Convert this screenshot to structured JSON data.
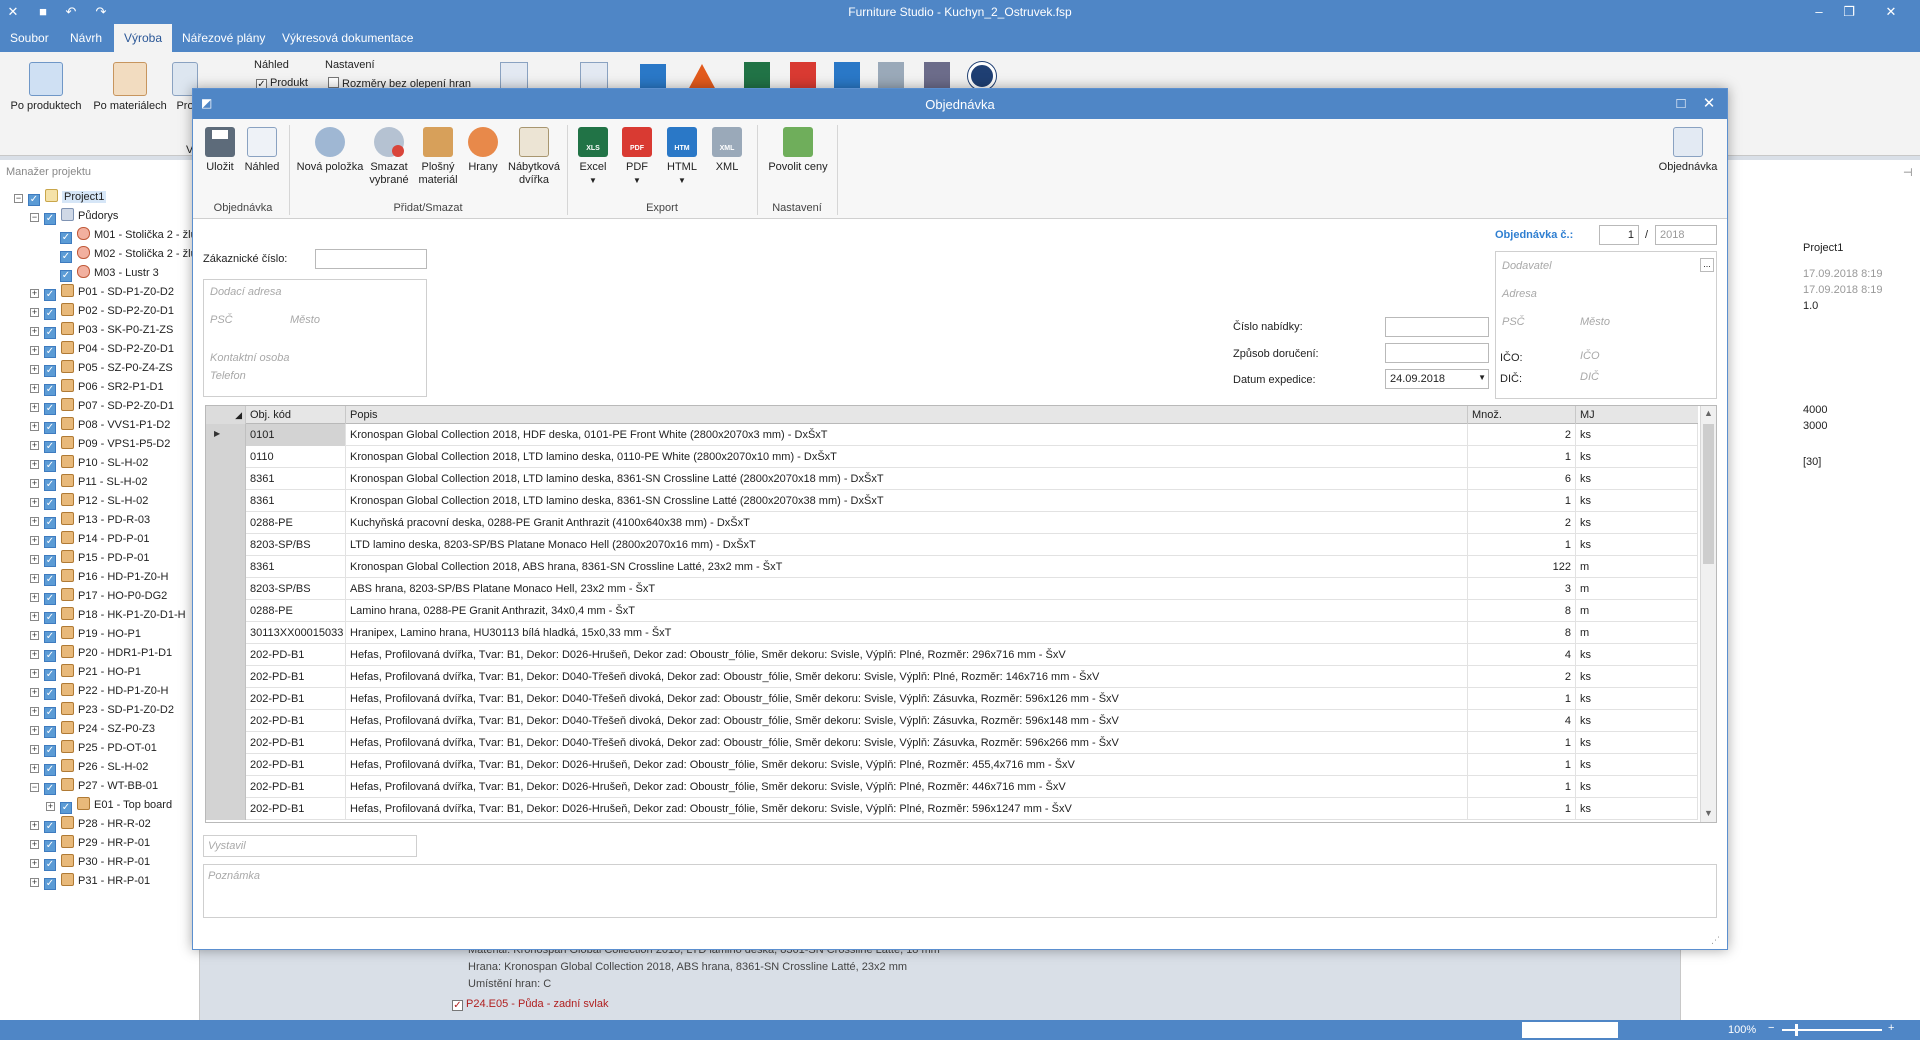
{
  "app": {
    "title": "Furniture Studio - Kuchyn_2_Ostruvek.fsp",
    "menu": [
      "Soubor",
      "Návrh",
      "Výroba",
      "Nářezové plány",
      "Výkresová dokumentace"
    ],
    "ribbon": {
      "po_produktech": "Po produktech",
      "po_materialech": "Po materiálech",
      "pro": "Pro",
      "nahled": "Náhled",
      "produkt": "Produkt",
      "nastaveni": "Nastavení",
      "rozmery": "Rozměry bez olepení hran",
      "v": "V"
    },
    "status": {
      "zoom": "100%"
    }
  },
  "project_panel": {
    "title": "Manažer projektu",
    "items": [
      {
        "label": "Project1",
        "level": 0,
        "icon": "proj",
        "exp": "−"
      },
      {
        "label": "Půdorys",
        "level": 1,
        "icon": "plan",
        "exp": "−"
      },
      {
        "label": "M01 - Stolička 2 - žlu",
        "level": 2,
        "icon": "mod",
        "exp": ""
      },
      {
        "label": "M02 - Stolička 2 - žlu",
        "level": 2,
        "icon": "mod",
        "exp": ""
      },
      {
        "label": "M03 - Lustr 3",
        "level": 2,
        "icon": "mod",
        "exp": ""
      },
      {
        "label": "P01 - SD-P1-Z0-D2",
        "level": 1,
        "icon": "prod",
        "exp": "+"
      },
      {
        "label": "P02 - SD-P2-Z0-D1",
        "level": 1,
        "icon": "prod",
        "exp": "+"
      },
      {
        "label": "P03 - SK-P0-Z1-ZS",
        "level": 1,
        "icon": "prod",
        "exp": "+"
      },
      {
        "label": "P04 - SD-P2-Z0-D1",
        "level": 1,
        "icon": "prod",
        "exp": "+"
      },
      {
        "label": "P05 - SZ-P0-Z4-ZS",
        "level": 1,
        "icon": "prod",
        "exp": "+"
      },
      {
        "label": "P06 - SR2-P1-D1",
        "level": 1,
        "icon": "prod",
        "exp": "+"
      },
      {
        "label": "P07 - SD-P2-Z0-D1",
        "level": 1,
        "icon": "prod",
        "exp": "+"
      },
      {
        "label": "P08 - VVS1-P1-D2",
        "level": 1,
        "icon": "prod",
        "exp": "+"
      },
      {
        "label": "P09 - VPS1-P5-D2",
        "level": 1,
        "icon": "prod",
        "exp": "+"
      },
      {
        "label": "P10 - SL-H-02",
        "level": 1,
        "icon": "prod",
        "exp": "+"
      },
      {
        "label": "P11 - SL-H-02",
        "level": 1,
        "icon": "prod",
        "exp": "+"
      },
      {
        "label": "P12 - SL-H-02",
        "level": 1,
        "icon": "prod",
        "exp": "+"
      },
      {
        "label": "P13 - PD-R-03",
        "level": 1,
        "icon": "prod",
        "exp": "+"
      },
      {
        "label": "P14 - PD-P-01",
        "level": 1,
        "icon": "prod",
        "exp": "+"
      },
      {
        "label": "P15 - PD-P-01",
        "level": 1,
        "icon": "prod",
        "exp": "+"
      },
      {
        "label": "P16 - HD-P1-Z0-H",
        "level": 1,
        "icon": "prod",
        "exp": "+"
      },
      {
        "label": "P17 - HO-P0-DG2",
        "level": 1,
        "icon": "prod",
        "exp": "+"
      },
      {
        "label": "P18 - HK-P1-Z0-D1-H",
        "level": 1,
        "icon": "prod",
        "exp": "+"
      },
      {
        "label": "P19 - HO-P1",
        "level": 1,
        "icon": "prod",
        "exp": "+"
      },
      {
        "label": "P20 - HDR1-P1-D1",
        "level": 1,
        "icon": "prod",
        "exp": "+"
      },
      {
        "label": "P21 - HO-P1",
        "level": 1,
        "icon": "prod",
        "exp": "+"
      },
      {
        "label": "P22 - HD-P1-Z0-H",
        "level": 1,
        "icon": "prod",
        "exp": "+"
      },
      {
        "label": "P23 - SD-P1-Z0-D2",
        "level": 1,
        "icon": "prod",
        "exp": "+"
      },
      {
        "label": "P24 - SZ-P0-Z3",
        "level": 1,
        "icon": "prod",
        "exp": "+"
      },
      {
        "label": "P25 - PD-OT-01",
        "level": 1,
        "icon": "prod",
        "exp": "+"
      },
      {
        "label": "P26 - SL-H-02",
        "level": 1,
        "icon": "prod",
        "exp": "+"
      },
      {
        "label": "P27 - WT-BB-01",
        "level": 1,
        "icon": "prod",
        "exp": "−"
      },
      {
        "label": "E01 - Top board",
        "level": 2,
        "icon": "prod",
        "exp": "+"
      },
      {
        "label": "P28 - HR-R-02",
        "level": 1,
        "icon": "prod",
        "exp": "+"
      },
      {
        "label": "P29 - HR-P-01",
        "level": 1,
        "icon": "prod",
        "exp": "+"
      },
      {
        "label": "P30 - HR-P-01",
        "level": 1,
        "icon": "prod",
        "exp": "+"
      },
      {
        "label": "P31 - HR-P-01",
        "level": 1,
        "icon": "prod",
        "exp": "+"
      }
    ]
  },
  "right_panel": {
    "rows": [
      {
        "k": "t",
        "v": ""
      },
      {
        "k": "projektu",
        "v": "Project1"
      },
      {
        "k": "eno",
        "v": "17.09.2018 8:19"
      },
      {
        "k": "eno",
        "v": "17.09.2018 8:19"
      },
      {
        "k": "",
        "v": "1.0"
      },
      {
        "k": "nik",
        "v": ""
      },
      {
        "k": "nik",
        "v": ""
      },
      {
        "k": "abídky",
        "v": ""
      },
      {
        "k": "akázky",
        "v": ""
      },
      {
        "k": "ry",
        "v": ""
      },
      {
        "k": "",
        "v": "4000"
      },
      {
        "k": "",
        "v": "3000"
      },
      {
        "k": "í",
        "v": ""
      },
      {
        "k": "etry",
        "v": "[30]"
      }
    ]
  },
  "behind": {
    "line1": "Materiál: Kronospan Global Collection 2018, LTD lamino deska, 8361-SN Crossline Latté, 18 mm",
    "line2": "Hrana: Kronospan Global Collection 2018, ABS hrana, 8361-SN Crossline Latté, 23x2 mm",
    "line3": "Umístění hran: C",
    "line4": "P24.E05 - Půda - zadní svlak"
  },
  "dialog": {
    "title": "Objednávka",
    "toolbar": {
      "ulozit": "Uložit",
      "nahled": "Náhled",
      "nova_polozka": "Nová položka",
      "smazat": "Smazat vybrané",
      "plosny": "Plošný materiál",
      "hrany": "Hrany",
      "nabytkova": "Nábytková dvířka",
      "excel": "Excel",
      "pdf": "PDF",
      "html": "HTML",
      "xml": "XML",
      "povolit": "Povolit ceny",
      "objednavka": "Objednávka",
      "g_objednavka": "Objednávka",
      "g_pridat": "Přidat/Smazat",
      "g_export": "Export",
      "g_nastaveni": "Nastavení"
    },
    "form": {
      "zakaznicke_cislo": "Zákaznické číslo:",
      "dodaci_adresa": "Dodací adresa",
      "psc": "PSČ",
      "mesto": "Město",
      "kontaktni_osoba": "Kontaktní osoba",
      "telefon": "Telefon",
      "cislo_nabidky": "Číslo nabídky:",
      "zpusob_doruceni": "Způsob doručení:",
      "datum_expedice": "Datum expedice:",
      "datum_value": "24.09.2018",
      "objednavka_c": "Objednávka č.:",
      "order_no": "1",
      "order_sep": "/",
      "order_year": "2018",
      "dodavatel": "Dodavatel",
      "adresa": "Adresa",
      "psc2": "PSČ",
      "mesto2": "Město",
      "ico_label": "IČO:",
      "ico_ph": "IČO",
      "dic_label": "DIČ:",
      "dic_ph": "DIČ",
      "vystavil": "Vystavil",
      "poznamka": "Poznámka",
      "dots": "..."
    },
    "grid": {
      "headers": [
        "Obj. kód",
        "Popis",
        "Množ.",
        "MJ"
      ],
      "rows": [
        {
          "kod": "0101",
          "popis": "Kronospan Global Collection 2018, HDF deska, 0101-PE Front White (2800x2070x3 mm) - DxŠxT",
          "mnoz": "2",
          "mj": "ks"
        },
        {
          "kod": "0110",
          "popis": "Kronospan Global Collection 2018, LTD lamino deska, 0110-PE White (2800x2070x10 mm) - DxŠxT",
          "mnoz": "1",
          "mj": "ks"
        },
        {
          "kod": "8361",
          "popis": "Kronospan Global Collection 2018, LTD lamino deska, 8361-SN Crossline Latté (2800x2070x18 mm) - DxŠxT",
          "mnoz": "6",
          "mj": "ks"
        },
        {
          "kod": "8361",
          "popis": "Kronospan Global Collection 2018, LTD lamino deska, 8361-SN Crossline Latté (2800x2070x38 mm) - DxŠxT",
          "mnoz": "1",
          "mj": "ks"
        },
        {
          "kod": "0288-PE",
          "popis": "Kuchyňská pracovní deska, 0288-PE Granit Anthrazit (4100x640x38 mm) - DxŠxT",
          "mnoz": "2",
          "mj": "ks"
        },
        {
          "kod": "8203-SP/BS",
          "popis": "LTD lamino deska, 8203-SP/BS Platane Monaco Hell (2800x2070x16 mm) - DxŠxT",
          "mnoz": "1",
          "mj": "ks"
        },
        {
          "kod": "8361",
          "popis": "Kronospan Global Collection 2018, ABS hrana, 8361-SN Crossline Latté, 23x2 mm - ŠxT",
          "mnoz": "122",
          "mj": "m"
        },
        {
          "kod": "8203-SP/BS",
          "popis": "ABS hrana, 8203-SP/BS Platane Monaco Hell, 23x2 mm - ŠxT",
          "mnoz": "3",
          "mj": "m"
        },
        {
          "kod": "0288-PE",
          "popis": "Lamino hrana, 0288-PE Granit Anthrazit, 34x0,4 mm - ŠxT",
          "mnoz": "8",
          "mj": "m"
        },
        {
          "kod": "30113XX00015033",
          "popis": "Hranipex, Lamino hrana, HU30113 bílá hladká, 15x0,33 mm - ŠxT",
          "mnoz": "8",
          "mj": "m"
        },
        {
          "kod": "202-PD-B1",
          "popis": "Hefas, Profilovaná dvířka, Tvar: B1, Dekor: D026-Hrušeň, Dekor zad: Oboustr_fólie, Směr dekoru: Svisle, Výplň: Plné, Rozměr: 296x716 mm - ŠxV",
          "mnoz": "4",
          "mj": "ks"
        },
        {
          "kod": "202-PD-B1",
          "popis": "Hefas, Profilovaná dvířka, Tvar: B1, Dekor: D040-Třešeň divoká, Dekor zad: Oboustr_fólie, Směr dekoru: Svisle, Výplň: Plné, Rozměr: 146x716 mm - ŠxV",
          "mnoz": "2",
          "mj": "ks"
        },
        {
          "kod": "202-PD-B1",
          "popis": "Hefas, Profilovaná dvířka, Tvar: B1, Dekor: D040-Třešeň divoká, Dekor zad: Oboustr_fólie, Směr dekoru: Svisle, Výplň: Zásuvka, Rozměr: 596x126 mm - ŠxV",
          "mnoz": "1",
          "mj": "ks"
        },
        {
          "kod": "202-PD-B1",
          "popis": "Hefas, Profilovaná dvířka, Tvar: B1, Dekor: D040-Třešeň divoká, Dekor zad: Oboustr_fólie, Směr dekoru: Svisle, Výplň: Zásuvka, Rozměr: 596x148 mm - ŠxV",
          "mnoz": "4",
          "mj": "ks"
        },
        {
          "kod": "202-PD-B1",
          "popis": "Hefas, Profilovaná dvířka, Tvar: B1, Dekor: D040-Třešeň divoká, Dekor zad: Oboustr_fólie, Směr dekoru: Svisle, Výplň: Zásuvka, Rozměr: 596x266 mm - ŠxV",
          "mnoz": "1",
          "mj": "ks"
        },
        {
          "kod": "202-PD-B1",
          "popis": "Hefas, Profilovaná dvířka, Tvar: B1, Dekor: D026-Hrušeň, Dekor zad: Oboustr_fólie, Směr dekoru: Svisle, Výplň: Plné, Rozměr: 455,4x716 mm - ŠxV",
          "mnoz": "1",
          "mj": "ks"
        },
        {
          "kod": "202-PD-B1",
          "popis": "Hefas, Profilovaná dvířka, Tvar: B1, Dekor: D026-Hrušeň, Dekor zad: Oboustr_fólie, Směr dekoru: Svisle, Výplň: Plné, Rozměr: 446x716 mm - ŠxV",
          "mnoz": "1",
          "mj": "ks"
        },
        {
          "kod": "202-PD-B1",
          "popis": "Hefas, Profilovaná dvířka, Tvar: B1, Dekor: D026-Hrušeň, Dekor zad: Oboustr_fólie, Směr dekoru: Svisle, Výplň: Plné, Rozměr: 596x1247 mm - ŠxV",
          "mnoz": "1",
          "mj": "ks"
        }
      ]
    }
  }
}
